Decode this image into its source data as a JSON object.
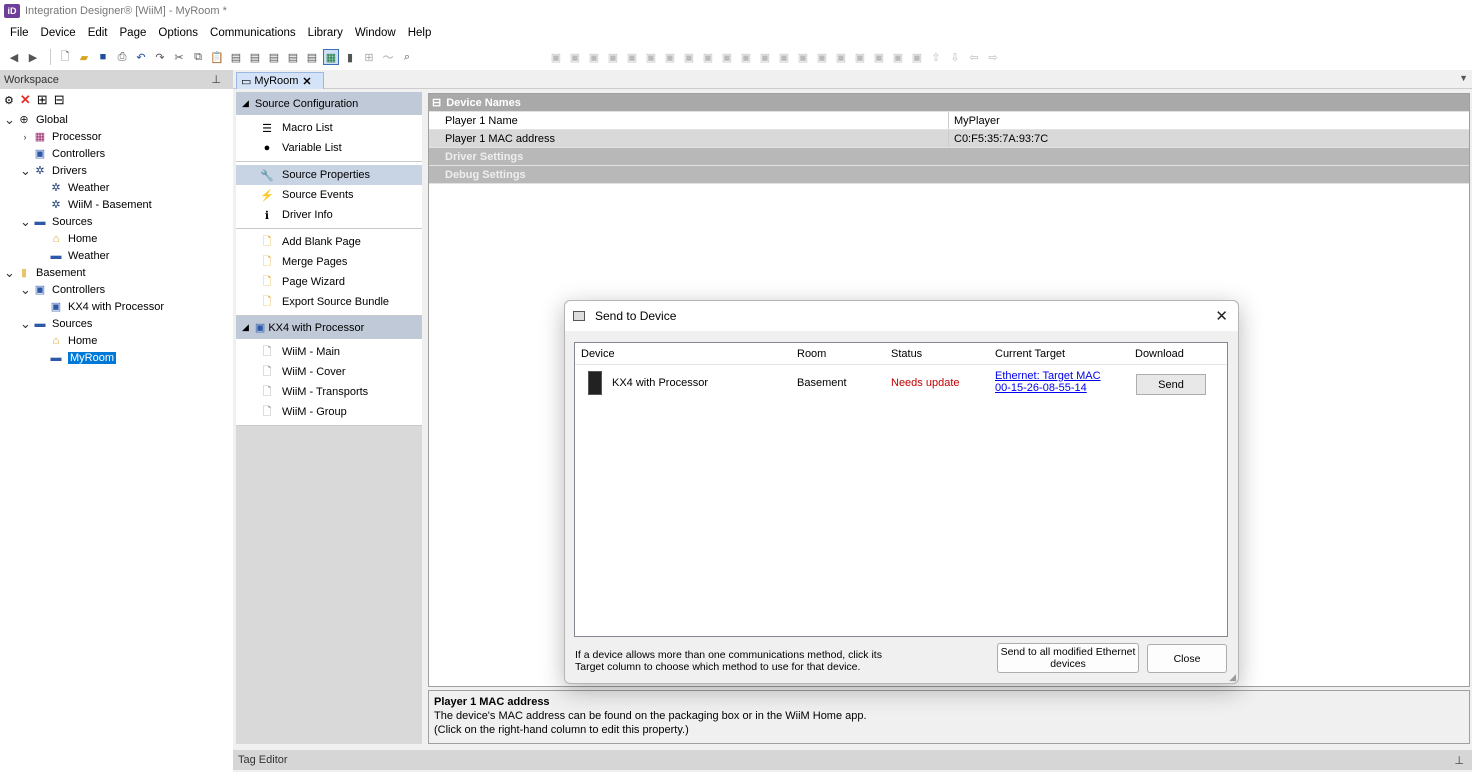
{
  "window": {
    "title": "Integration Designer® [WiiM] - MyRoom *",
    "logo": "iD"
  },
  "menu": [
    "File",
    "Device",
    "Edit",
    "Page",
    "Options",
    "Communications",
    "Library",
    "Window",
    "Help"
  ],
  "workspace": {
    "title": "Workspace",
    "tree": [
      {
        "label": "Global",
        "icon": "globe-icon",
        "level": 0,
        "expanded": true
      },
      {
        "label": "Processor",
        "icon": "processor-icon",
        "level": 1,
        "expanded": false,
        "collapsed": true
      },
      {
        "label": "Controllers",
        "icon": "controller-icon",
        "level": 1
      },
      {
        "label": "Drivers",
        "icon": "gear-icon",
        "level": 1,
        "expanded": true
      },
      {
        "label": "Weather",
        "icon": "gear-icon",
        "level": 2
      },
      {
        "label": "WiiM - Basement",
        "icon": "gear-icon",
        "level": 2
      },
      {
        "label": "Sources",
        "icon": "source-icon",
        "level": 1,
        "expanded": true
      },
      {
        "label": "Home",
        "icon": "home-icon",
        "level": 2
      },
      {
        "label": "Weather",
        "icon": "source-icon",
        "level": 2
      },
      {
        "label": "Basement",
        "icon": "folder-icon",
        "level": 0,
        "expanded": true
      },
      {
        "label": "Controllers",
        "icon": "controller-icon",
        "level": 1,
        "expanded": true
      },
      {
        "label": "KX4 with Processor",
        "icon": "controller-icon",
        "level": 2
      },
      {
        "label": "Sources",
        "icon": "source-icon",
        "level": 1,
        "expanded": true
      },
      {
        "label": "Home",
        "icon": "home-icon",
        "level": 2
      },
      {
        "label": "MyRoom",
        "icon": "source-icon",
        "level": 2,
        "selected": true
      }
    ]
  },
  "doc_tab": {
    "label": "MyRoom"
  },
  "nav": {
    "section1": "Source Configuration",
    "group1": [
      {
        "label": "Macro List",
        "icon": "list-icon"
      },
      {
        "label": "Variable List",
        "icon": "variable-icon"
      }
    ],
    "group2": [
      {
        "label": "Source Properties",
        "icon": "wrench-icon",
        "active": true
      },
      {
        "label": "Source Events",
        "icon": "lightning-icon"
      },
      {
        "label": "Driver Info",
        "icon": "info-icon"
      }
    ],
    "group3": [
      {
        "label": "Add Blank Page",
        "icon": "page-add-icon"
      },
      {
        "label": "Merge Pages",
        "icon": "page-add-icon"
      },
      {
        "label": "Page Wizard",
        "icon": "page-add-icon"
      },
      {
        "label": "Export Source Bundle",
        "icon": "page-add-icon"
      }
    ],
    "section2": "KX4 with Processor",
    "group4": [
      {
        "label": "WiiM - Main",
        "icon": "page-icon"
      },
      {
        "label": "WiiM - Cover",
        "icon": "page-icon"
      },
      {
        "label": "WiiM - Transports",
        "icon": "page-icon"
      },
      {
        "label": "WiiM - Group",
        "icon": "page-icon"
      }
    ]
  },
  "properties": {
    "category1": "Device Names",
    "rows": [
      {
        "name": "Player 1 Name",
        "value": "MyPlayer"
      },
      {
        "name": "Player 1 MAC address",
        "value": "C0:F5:35:7A:93:7C"
      }
    ],
    "category2": "Driver Settings",
    "category3": "Debug Settings"
  },
  "description": {
    "title": "Player 1 MAC address",
    "line1": "The device's MAC address can be found on the packaging box or in the WiiM Home app.",
    "line2": "(Click on the right-hand column to edit this property.)"
  },
  "tag_editor": "Tag Editor",
  "dialog": {
    "title": "Send to Device",
    "columns": [
      "Device",
      "Room",
      "Status",
      "Current Target",
      "Download"
    ],
    "rows": [
      {
        "device": "KX4 with Processor",
        "room": "Basement",
        "status": "Needs update",
        "target_line1": "Ethernet: Target MAC",
        "target_line2": "00-15-26-08-55-14",
        "button": "Send"
      }
    ],
    "footer_line1": "If a device allows more than one communications method, click its",
    "footer_line2": "Target column to choose which method to use for that device.",
    "send_all_line1": "Send to all modified Ethernet",
    "send_all_line2": "devices",
    "close": "Close",
    "status_color": "#c00000"
  }
}
